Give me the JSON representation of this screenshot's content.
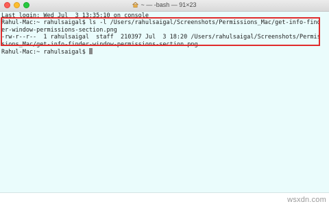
{
  "window": {
    "title": "~ — -bash — 91×23",
    "title_icon": "home-folder-icon"
  },
  "terminal": {
    "lines": [
      "Last login: Wed Jul  3 13:35:10 on console",
      "Rahul-Mac:~ rahulsaigal$ ls -l /Users/rahulsaigal/Screenshots/Permissions_Mac/get-info-find",
      "er-window-permissions-section.png",
      "-rw-r--r--  1 rahulsaigal  staff  210397 Jul  3 18:20 /Users/rahulsaigal/Screenshots/Permis",
      "sions_Mac/get-info-finder-window-permissions-section.png"
    ],
    "prompt": "Rahul-Mac:~ rahulsaigal$ "
  },
  "colors": {
    "background": "#eafcfc",
    "highlight": "#e02b2b"
  },
  "watermark": "wsxdn.com"
}
